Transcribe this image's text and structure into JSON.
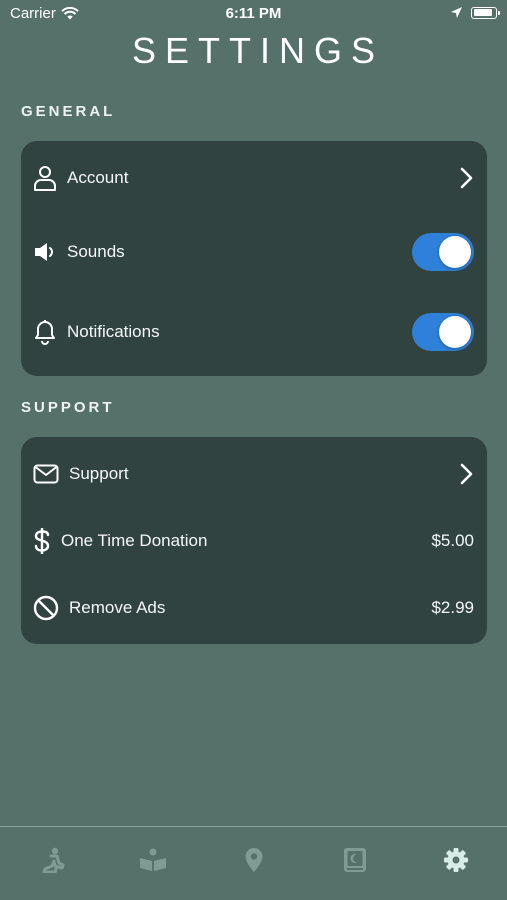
{
  "status_bar": {
    "carrier": "Carrier",
    "time": "6:11 PM",
    "battery_level": 0.92,
    "icons": [
      "wifi-icon",
      "location-arrow-icon",
      "battery-icon"
    ]
  },
  "page_title": "SETTINGS",
  "general": {
    "heading": "GENERAL",
    "account": {
      "label": "Account",
      "icon": "person-icon"
    },
    "sounds": {
      "label": "Sounds",
      "icon": "speaker-icon",
      "enabled": true
    },
    "notifications": {
      "label": "Notifications",
      "icon": "bell-icon",
      "enabled": true
    }
  },
  "support": {
    "heading": "SUPPORT",
    "support": {
      "label": "Support",
      "icon": "envelope-icon"
    },
    "donation": {
      "label": "One Time Donation",
      "value": "$5.00",
      "icon": "dollar-icon"
    },
    "remove_ads": {
      "label": "Remove Ads",
      "value": "$2.99",
      "icon": "prohibited-icon"
    }
  },
  "tab_bar": {
    "tabs": [
      "pray-tab",
      "book-tab",
      "location-tab",
      "journal-tab",
      "settings-tab"
    ],
    "active": "settings-tab"
  },
  "colors": {
    "background": "#56706a",
    "card": "#314341",
    "toggle_on": "#2f80d8",
    "tab_inactive": "#7e9c94",
    "tab_active": "#d8ece6"
  }
}
